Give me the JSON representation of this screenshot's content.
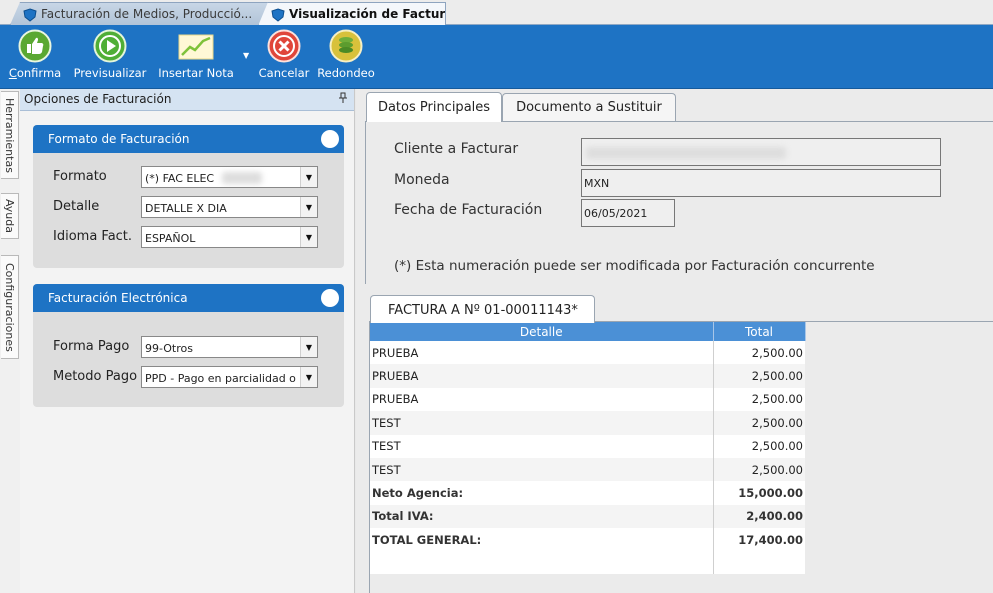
{
  "tabs": [
    {
      "label": "Facturación de Medios, Producció...",
      "active": false
    },
    {
      "label": "Visualización de Factura",
      "active": true
    }
  ],
  "toolbar": {
    "buttons": [
      {
        "label": "Confirma",
        "accesskey": "C",
        "icon": "thumbs-up-icon"
      },
      {
        "label": "Previsualizar",
        "icon": "play-icon"
      },
      {
        "label": "Insertar Nota",
        "icon": "chart-note-icon"
      },
      {
        "label": "Cancelar",
        "icon": "cancel-x-icon"
      },
      {
        "label": "Redondeo",
        "icon": "coins-icon"
      }
    ],
    "colors": {
      "background": "#1e73c4"
    }
  },
  "side_tabs": [
    "Herramientas",
    "Ayuda",
    "Configuraciones"
  ],
  "left_panel": {
    "title": "Opciones de Facturación",
    "groups": {
      "formato": {
        "title": "Formato de Facturación",
        "fields": [
          {
            "label": "Formato",
            "value": "(*) FAC ELEC"
          },
          {
            "label": "Detalle",
            "value": "DETALLE X DIA"
          },
          {
            "label": "Idioma Fact.",
            "value": "ESPAÑOL"
          }
        ]
      },
      "electronica": {
        "title": "Facturación Electrónica",
        "fields": [
          {
            "label": "Forma Pago",
            "value": "99-Otros"
          },
          {
            "label": "Metodo Pago",
            "value": "PPD - Pago en parcialidad o"
          }
        ]
      }
    }
  },
  "main": {
    "tabs": [
      "Datos Principales",
      "Documento a Sustituir"
    ],
    "fields": [
      {
        "label": "Cliente a Facturar",
        "value": ""
      },
      {
        "label": "Moneda",
        "value": "MXN"
      },
      {
        "label": "Fecha de Facturación",
        "value": "06/05/2021"
      }
    ],
    "note": "(*) Esta numeración puede ser modificada por Facturación concurrente"
  },
  "invoice": {
    "tab_label": "FACTURA A Nº 01-00011143*",
    "columns": [
      "Detalle",
      "Total"
    ],
    "rows": [
      {
        "detalle": "PRUEBA",
        "total": "2,500.00"
      },
      {
        "detalle": "PRUEBA",
        "total": "2,500.00"
      },
      {
        "detalle": "PRUEBA",
        "total": "2,500.00"
      },
      {
        "detalle": "TEST",
        "total": "2,500.00"
      },
      {
        "detalle": "TEST",
        "total": "2,500.00"
      },
      {
        "detalle": "TEST",
        "total": "2,500.00"
      }
    ],
    "summary": [
      {
        "detalle": "Neto Agencia:",
        "total": "15,000.00"
      },
      {
        "detalle": "Total IVA:",
        "total": "2,400.00"
      },
      {
        "detalle": "TOTAL GENERAL:",
        "total": "17,400.00"
      }
    ]
  }
}
